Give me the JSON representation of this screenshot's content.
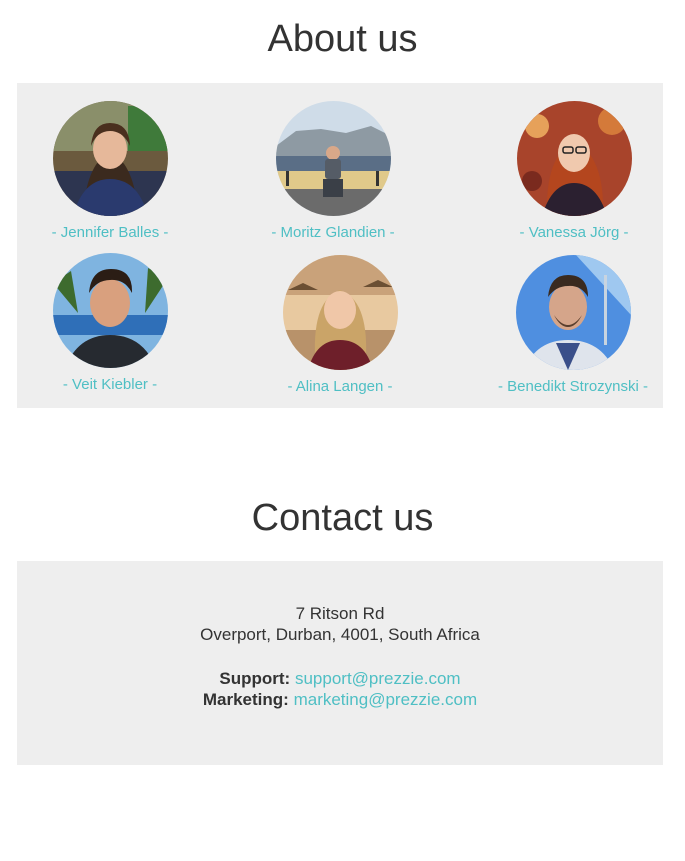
{
  "about": {
    "title": "About us",
    "members": [
      {
        "name": "- Jennifer Balles -",
        "photo": "jennifer-balles-photo"
      },
      {
        "name": "- Moritz Glandien -",
        "photo": "moritz-glandien-photo"
      },
      {
        "name": "- Vanessa Jörg -",
        "photo": "vanessa-joerg-photo"
      },
      {
        "name": "- Veit Kiebler -",
        "photo": "veit-kiebler-photo"
      },
      {
        "name": "- Alina Langen -",
        "photo": "alina-langen-photo"
      },
      {
        "name": "- Benedikt Strozynski -",
        "photo": "benedikt-strozynski-photo"
      }
    ]
  },
  "contact": {
    "title": "Contact us",
    "address_line1": "7 Ritson Rd",
    "address_line2": "Overport, Durban, 4001, South Africa",
    "support_label": "Support:",
    "support_email": "support@prezzie.com",
    "marketing_label": "Marketing:",
    "marketing_email": "marketing@prezzie.com"
  },
  "colors": {
    "accent": "#4fbfc4",
    "panel_bg": "#eeeeee",
    "text": "#333333"
  }
}
